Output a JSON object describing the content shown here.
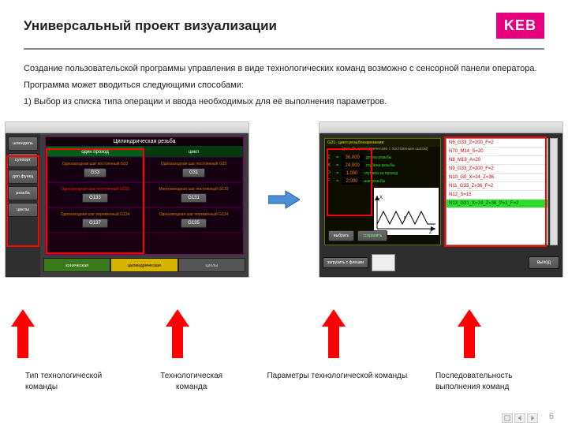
{
  "header": {
    "title": "Универсальный проект визуализации",
    "logo_text": "KEB"
  },
  "paragraphs": {
    "p1": "Создание пользовательской программы управления в виде технологических команд возможно с сенсорной панели оператора.",
    "p2": "Программа может вводиться следующими способами:",
    "p3": "1) Выбор из списка типа операции и ввода  необходимых для её выполнения параметров."
  },
  "left_window": {
    "sidebar": [
      "шпиндель",
      "суппорт",
      "доп.функц",
      "резьба",
      "циклы"
    ],
    "panel_title": "Цилиндрическая резьба",
    "col_heads": [
      "один проход",
      "цикл"
    ],
    "rows": [
      {
        "left_label": "Однозаходная шаг постоянный G33",
        "left_btn": "G33",
        "right_label": "Однозаходная шаг постоянный G33",
        "right_btn": "G31"
      },
      {
        "left_label": "Однозаходная шаг постоянный G133",
        "left_btn": "G133",
        "right_label": "Многозаходная шаг постоянный G133",
        "right_btn": "G131"
      },
      {
        "left_label": "Однозаходная шаг переменный G134",
        "left_btn": "G137",
        "right_label": "Однозаходная шаг переменный G134",
        "right_btn": "G135"
      }
    ],
    "bottom_tabs": [
      "коническая",
      "цилиндрическая",
      "циклы"
    ]
  },
  "right_window": {
    "g31_title": "G31- цикл резьбонарезания",
    "g31_sub": "(резьба цилиндрическая с постоянным шагом)",
    "params": [
      {
        "letter": "Z",
        "value": "36,000",
        "desc": "длина резьбы"
      },
      {
        "letter": "X",
        "value": "24,000",
        "desc": "глубина резьбы"
      },
      {
        "letter": "P",
        "value": "1,000",
        "desc": "глубина за проход"
      },
      {
        "letter": "F",
        "value": "2,000",
        "desc": "шаг резьбы"
      }
    ],
    "buttons": {
      "select": "выбрать",
      "save": "сохранить"
    },
    "code_lines": [
      "N6_G33_Z=200_F=2",
      "N70_M14_S=20",
      "N8_M19_A=20",
      "N9_G33_Z=200_F=2",
      "N10_G0_X=24_Z=36",
      "N11_G33_Z=36_F=2",
      "N12_S=15",
      "N13_G31_X=24_Z=36_P=1_F=2"
    ],
    "bottom": {
      "load": "загрузить с флешки",
      "exit": "выход"
    }
  },
  "captions": {
    "c1": "Тип технологической команды",
    "c2": "Технологическая команда",
    "c3": "Параметры технологической команды",
    "c4": "Последовательность выполнения команд"
  },
  "page_number": "6"
}
